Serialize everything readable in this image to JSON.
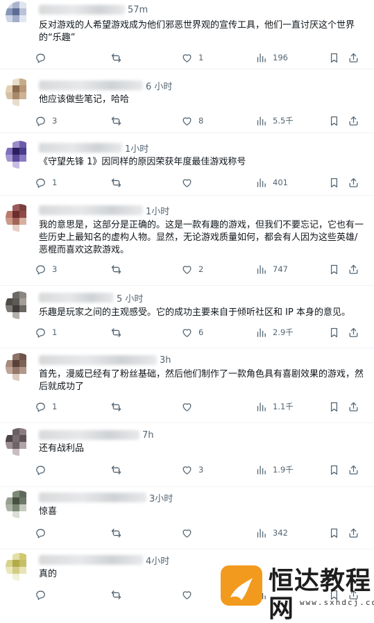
{
  "tweets": [
    {
      "time": "57m",
      "text": "反对游戏的人希望游戏成为他们邪恶世界观的宣传工具，他们一直讨厌这个世界的“乐趣”",
      "reply": "",
      "retweet": "",
      "like": "1",
      "views": "196",
      "avatar": [
        "#c9d4e6",
        "#a9b4cc",
        "#dfe4ee",
        "#ffffff",
        "#8796b8",
        "#5d6c96",
        "#b8c2d8",
        "#ffffff",
        "#cdd5e6",
        "#a2aecb",
        "#e3e8f0",
        "#ffffff",
        "#ffffff",
        "#ffffff",
        "#ffffff",
        "#ffffff"
      ]
    },
    {
      "time": "6 小时",
      "text": "他应该做些笔记，哈哈",
      "reply": "3",
      "retweet": "",
      "like": "8",
      "views": "5.5千",
      "avatar": [
        "#ffffff",
        "#e9dcc9",
        "#c6ab8b",
        "#ffffff",
        "#e3cfb2",
        "#8a6b4f",
        "#b99878",
        "#ffffff",
        "#d6c0a2",
        "#a9896b",
        "#cdb394",
        "#ffffff",
        "#ffffff",
        "#e8dcca",
        "#ffffff",
        "#ffffff"
      ]
    },
    {
      "time": "1小时",
      "text": "《守望先锋 1》因同样的原因荣获年度最佳游戏称号",
      "reply": "1",
      "retweet": "",
      "like": "",
      "views": "401",
      "avatar": [
        "#ffffff",
        "#9b8cc9",
        "#6d5aa8",
        "#ffffff",
        "#7f6fbc",
        "#2a1f5e",
        "#4b3c8e",
        "#ffffff",
        "#a597d0",
        "#5b4a9c",
        "#8a7bc2",
        "#ffffff",
        "#ffffff",
        "#c7bde3",
        "#ffffff",
        "#ffffff"
      ]
    },
    {
      "time": "1小时",
      "text": "我的意思是，这部分是正确的。这是一款有趣的游戏，但我们不要忘记，它也有一些历史上最知名的虚构人物。显然，无论游戏质量如何，都会有人因为这些英雄/恶棍而喜欢这款游戏。",
      "reply": "3",
      "retweet": "",
      "like": "2",
      "views": "747",
      "avatar": [
        "#ffffff",
        "#9a5b5b",
        "#7a3f3f",
        "#ffffff",
        "#b97a6a",
        "#6b2d2d",
        "#8f4a48",
        "#ffffff",
        "#c99a8a",
        "#a36458",
        "#d8b0a0",
        "#ffffff",
        "#ffffff",
        "#e7cfc5",
        "#ffffff",
        "#ffffff"
      ]
    },
    {
      "time": "5 小时",
      "text": "乐趣是玩家之间的主观感受。它的成功主要来自于倾听社区和 IP 本身的意见。",
      "reply": "1",
      "retweet": "",
      "like": "6",
      "views": "2.9千",
      "avatar": [
        "#ffffff",
        "#6d6a66",
        "#8b8782",
        "#ffffff",
        "#4e4b47",
        "#5d5955",
        "#a29d97",
        "#ffffff",
        "#7e7a75",
        "#3f3c39",
        "#6a6661",
        "#ffffff",
        "#ffffff",
        "#b5b0aa",
        "#ffffff",
        "#ffffff"
      ]
    },
    {
      "time": "3h",
      "text": "首先，漫威已经有了粉丝基础，然后他们制作了一款角色具有喜剧效果的游戏，然后就成功了",
      "reply": "1",
      "retweet": "",
      "like": "",
      "views": "1.1千",
      "avatar": [
        "#ffffff",
        "#8c7266",
        "#6e544b",
        "#ffffff",
        "#a68a7c",
        "#5a4038",
        "#7d6256",
        "#ffffff",
        "#c0a696",
        "#92776a",
        "#b29888",
        "#ffffff",
        "#ffffff",
        "#ddc9bd",
        "#ffffff",
        "#ffffff"
      ]
    },
    {
      "time": "7h",
      "text": "还有战利品",
      "reply": "",
      "retweet": "",
      "like": "3",
      "views": "1.9千",
      "avatar": [
        "#ffffff",
        "#6a5f63",
        "#8a7c80",
        "#ffffff",
        "#4d4549",
        "#7a6c70",
        "#5c5256",
        "#ffffff",
        "#9b8d90",
        "#6e6367",
        "#b1a4a7",
        "#ffffff",
        "#ffffff",
        "#c8bdbf",
        "#ffffff",
        "#ffffff"
      ]
    },
    {
      "time": "3小时",
      "text": "惊喜",
      "reply": "",
      "retweet": "",
      "like": "",
      "views": "342",
      "avatar": [
        "#ffffff",
        "#7e8a78",
        "#5f6b5a",
        "#ffffff",
        "#96a090",
        "#47513f",
        "#6d7866",
        "#ffffff",
        "#aab4a4",
        "#7c8774",
        "#c4ccbe",
        "#ffffff",
        "#ffffff",
        "#d9dfd5",
        "#ffffff",
        "#ffffff"
      ]
    },
    {
      "time": "4小时",
      "text": "真的",
      "reply": "",
      "retweet": "",
      "like": "",
      "views": "",
      "avatar": [
        "#ffffff",
        "#e3dfa5",
        "#cfc86f",
        "#ffffff",
        "#d9d28a",
        "#b3ab4a",
        "#c6bf66",
        "#ffffff",
        "#ebe7bd",
        "#d2cc84",
        "#e8e4b4",
        "#ffffff",
        "#ffffff",
        "#f2f0d6",
        "#ffffff",
        "#ffffff"
      ]
    }
  ],
  "watermark": {
    "text": "恒达教程网",
    "url": "www.sxhdcj.com"
  }
}
